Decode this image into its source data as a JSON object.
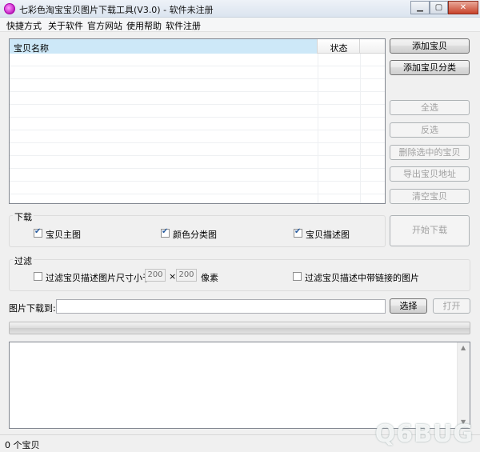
{
  "window": {
    "title": "七彩色淘宝宝贝图片下载工具(V3.0) - 软件未注册",
    "minimize_icon": "minimize-icon",
    "maximize_icon": "maximize-icon",
    "close_icon": "close-icon"
  },
  "menu": [
    "快捷方式",
    "关于软件",
    "官方网站",
    "使用帮助",
    "软件注册"
  ],
  "list": {
    "columns": [
      "宝贝名称",
      "状态"
    ],
    "rows": []
  },
  "side_buttons": {
    "add_item": "添加宝贝",
    "add_category": "添加宝贝分类",
    "select_all": "全选",
    "invert": "反选",
    "delete_selected": "删除选中的宝贝",
    "export_urls": "导出宝贝地址",
    "clear": "清空宝贝"
  },
  "download_group": {
    "label": "下载",
    "main_image": {
      "label": "宝贝主图",
      "checked": true
    },
    "color_image": {
      "label": "颜色分类图",
      "checked": true
    },
    "desc_image": {
      "label": "宝贝描述图",
      "checked": true
    },
    "start_button": "开始下载"
  },
  "filter_group": {
    "label": "过滤",
    "size_filter_label": "过滤宝贝描述图片尺寸小于:",
    "width": "200",
    "times": "×",
    "height": "200",
    "unit": "像素",
    "link_filter_label": "过滤宝贝描述中带链接的图片"
  },
  "save_to": {
    "label": "图片下载到:",
    "value": "",
    "browse": "选择",
    "open": "打开"
  },
  "progress": 0,
  "status": "0 个宝贝",
  "watermark": "Q6BUG"
}
